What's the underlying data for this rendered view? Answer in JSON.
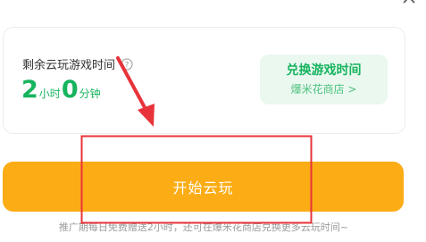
{
  "card": {
    "remain_label": "剩余云玩游戏时间",
    "hours": "2",
    "hours_unit": "小时",
    "minutes": "0",
    "minutes_unit": "分钟",
    "exchange": {
      "title": "兑换游戏时间",
      "subtitle": "爆米花商店 >"
    }
  },
  "start_button": {
    "label": "开始云玩"
  },
  "footnote": "推广期每日免费赠送2小时，还可在爆米花商店兑换更多云玩时间~",
  "colors": {
    "accent_green": "#17b45e",
    "button_orange": "#fcac14",
    "annotation_red": "#e8333a"
  },
  "icons": [
    "close-icon",
    "help-icon"
  ]
}
